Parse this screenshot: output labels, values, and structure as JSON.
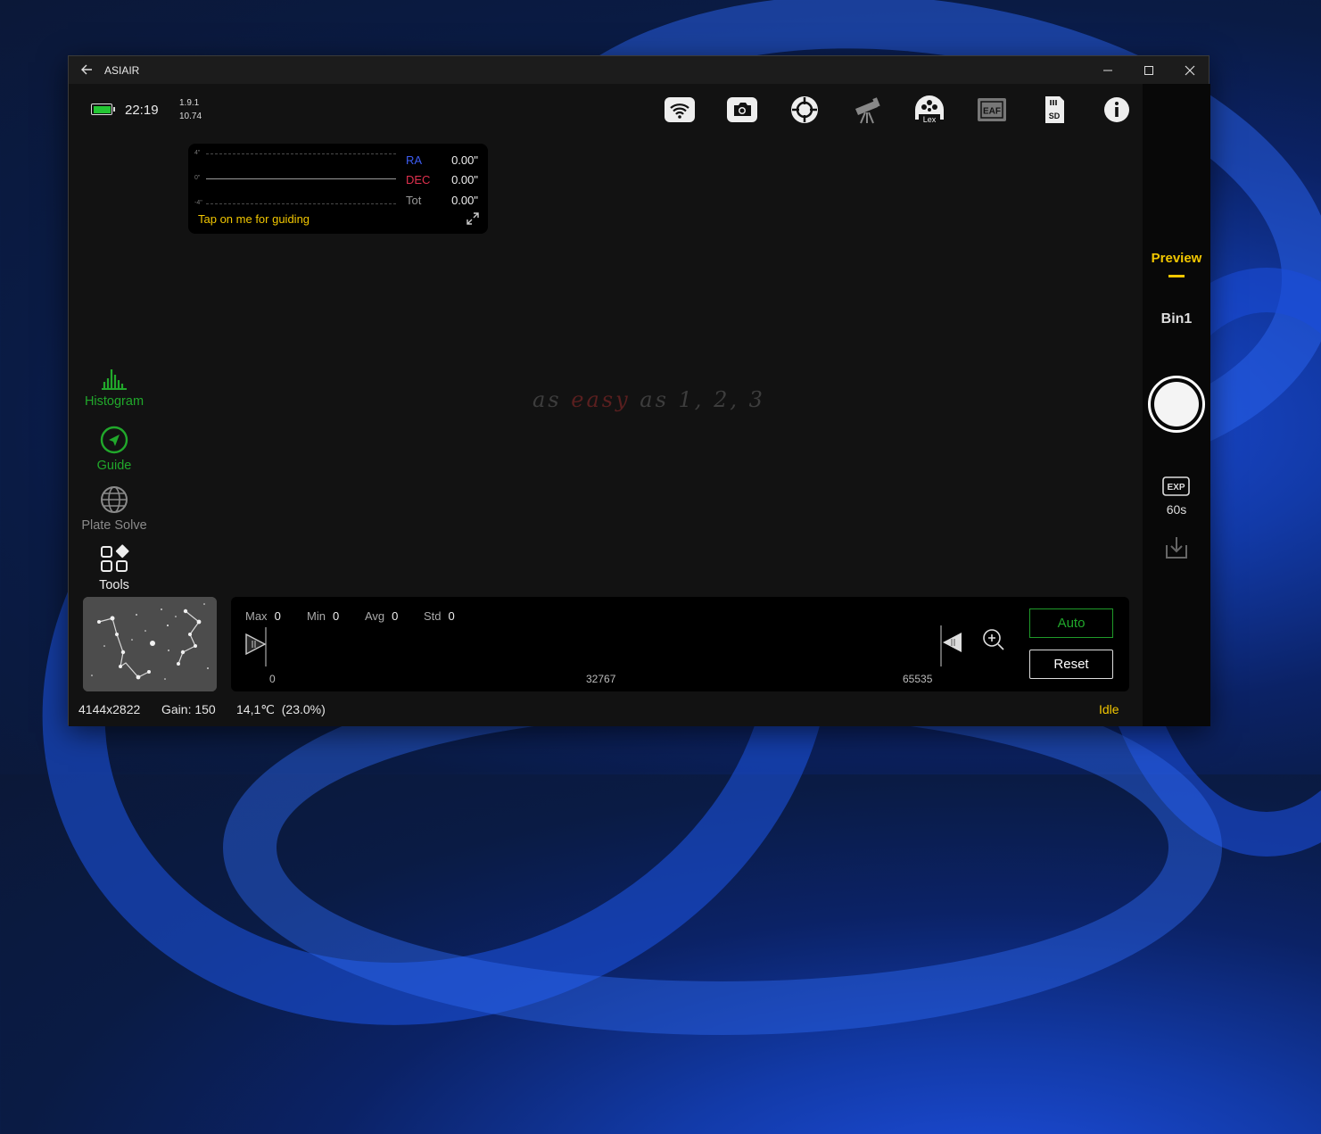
{
  "window": {
    "title": "ASIAIR"
  },
  "status_bar": {
    "time": "22:19",
    "version_line1": "1.9.1",
    "version_line2": "10.74"
  },
  "top_icons": [
    "wifi-icon",
    "camera-icon",
    "guide-scope-icon",
    "telescope-icon",
    "filter-wheel-icon",
    "eaf-icon",
    "sd-card-icon",
    "info-icon"
  ],
  "top_icon_labels": {
    "filter_wheel": "Lex",
    "eaf": "EAF",
    "sd": "SD"
  },
  "guide_panel": {
    "tick_top": "4\"",
    "tick_mid": "0\"",
    "tick_bot": "-4\"",
    "ra_label": "RA",
    "ra_value": "0.00\"",
    "dec_label": "DEC",
    "dec_value": "0.00\"",
    "tot_label": "Tot",
    "tot_value": "0.00\"",
    "hint": "Tap on me for guiding"
  },
  "watermark": {
    "part1": "as ",
    "part2": "easy",
    "part3": " as 1, 2, 3"
  },
  "tools": {
    "histogram": "Histogram",
    "guide": "Guide",
    "plate_solve": "Plate Solve",
    "tools": "Tools"
  },
  "histogram": {
    "max_label": "Max",
    "max_value": "0",
    "min_label": "Min",
    "min_value": "0",
    "avg_label": "Avg",
    "avg_value": "0",
    "std_label": "Std",
    "std_value": "0",
    "axis_0": "0",
    "axis_mid": "32767",
    "axis_max": "65535",
    "auto_label": "Auto",
    "reset_label": "Reset"
  },
  "footer": {
    "resolution": "4144x2822",
    "gain": "Gain: 150",
    "temperature": "14,1℃  (23.0%)",
    "state": "Idle"
  },
  "right_panel": {
    "mode": "Preview",
    "bin": "Bin1",
    "exp_icon_label": "EXP",
    "exposure": "60s"
  },
  "colors": {
    "accent_yellow": "#f2c700",
    "accent_green": "#21a82b",
    "ra_blue": "#3d5cf0",
    "dec_red": "#e0304e"
  }
}
